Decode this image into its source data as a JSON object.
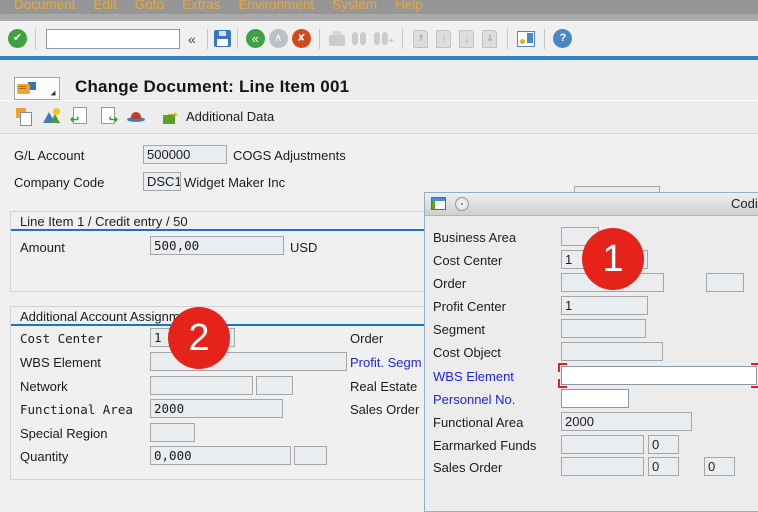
{
  "menubar": {
    "items": [
      "Document",
      "Edit",
      "Goto",
      "Extras",
      "Environment",
      "System",
      "Help"
    ]
  },
  "toolbar": {
    "command_field": {
      "value": ""
    },
    "icons": {
      "enter": "✔",
      "collapse": "«",
      "back": "«",
      "exit": "∧",
      "cancel": "✘",
      "page_first": "⇑",
      "page_up": "↑",
      "page_down": "↓",
      "page_last": "⇓",
      "help": "?"
    }
  },
  "title": {
    "text": "Change Document: Line Item 001"
  },
  "app_toolbar": {
    "additional_data_label": "Additional Data"
  },
  "header_fields": {
    "gl_account": {
      "label": "G/L Account",
      "value": "500000",
      "description": "COGS Adjustments"
    },
    "company_code": {
      "label": "Company Code",
      "value": "DSC1",
      "description": "Widget Maker Inc"
    }
  },
  "line_item_box": {
    "title": "Line Item 1 / Credit entry / 50",
    "amount": {
      "label": "Amount",
      "value": "500,00",
      "currency": "USD"
    }
  },
  "assignments_box": {
    "title": "Additional Account Assignments",
    "cost_center": {
      "label": "Cost Center",
      "value": "1"
    },
    "wbs_element": {
      "label": "WBS Element",
      "value": ""
    },
    "network": {
      "label": "Network",
      "value": "",
      "value2": ""
    },
    "functional_area": {
      "label": "Functional Area",
      "value": "2000"
    },
    "special_region": {
      "label": "Special Region",
      "value": ""
    },
    "quantity": {
      "label": "Quantity",
      "value": "0,000",
      "unit": ""
    },
    "right_labels": {
      "order": "Order",
      "profit_segment": "Profit. Segm",
      "real_estate": "Real Estate",
      "sales_order": "Sales Order"
    }
  },
  "annotations": {
    "badge_popup": "1",
    "badge_form": "2",
    "color": "#e5231b"
  },
  "popup": {
    "title": "Codi",
    "business_area": {
      "label": "Business Area",
      "value": ""
    },
    "cost_center": {
      "label": "Cost Center",
      "value": "1"
    },
    "order": {
      "label": "Order",
      "value": "",
      "value2": ""
    },
    "profit_center": {
      "label": "Profit Center",
      "value": "1"
    },
    "segment": {
      "label": "Segment",
      "value": ""
    },
    "cost_object": {
      "label": "Cost Object",
      "value": ""
    },
    "wbs_element": {
      "label": "WBS Element",
      "value": ""
    },
    "personnel_no": {
      "label": "Personnel No.",
      "value": ""
    },
    "functional_area": {
      "label": "Functional Area",
      "value": "2000"
    },
    "earmarked_funds": {
      "label": "Earmarked Funds",
      "value": "",
      "value2": "0"
    },
    "sales_order": {
      "label": "Sales Order",
      "value": "",
      "value2": "0",
      "value3": "0"
    }
  },
  "colors": {
    "toolbar_rule_blue": "#2f83c5",
    "section_rule_blue": "#1677bd",
    "link_blue": "#2323d6",
    "menu_text": "#eca63a",
    "badge_red": "#e5231b"
  }
}
